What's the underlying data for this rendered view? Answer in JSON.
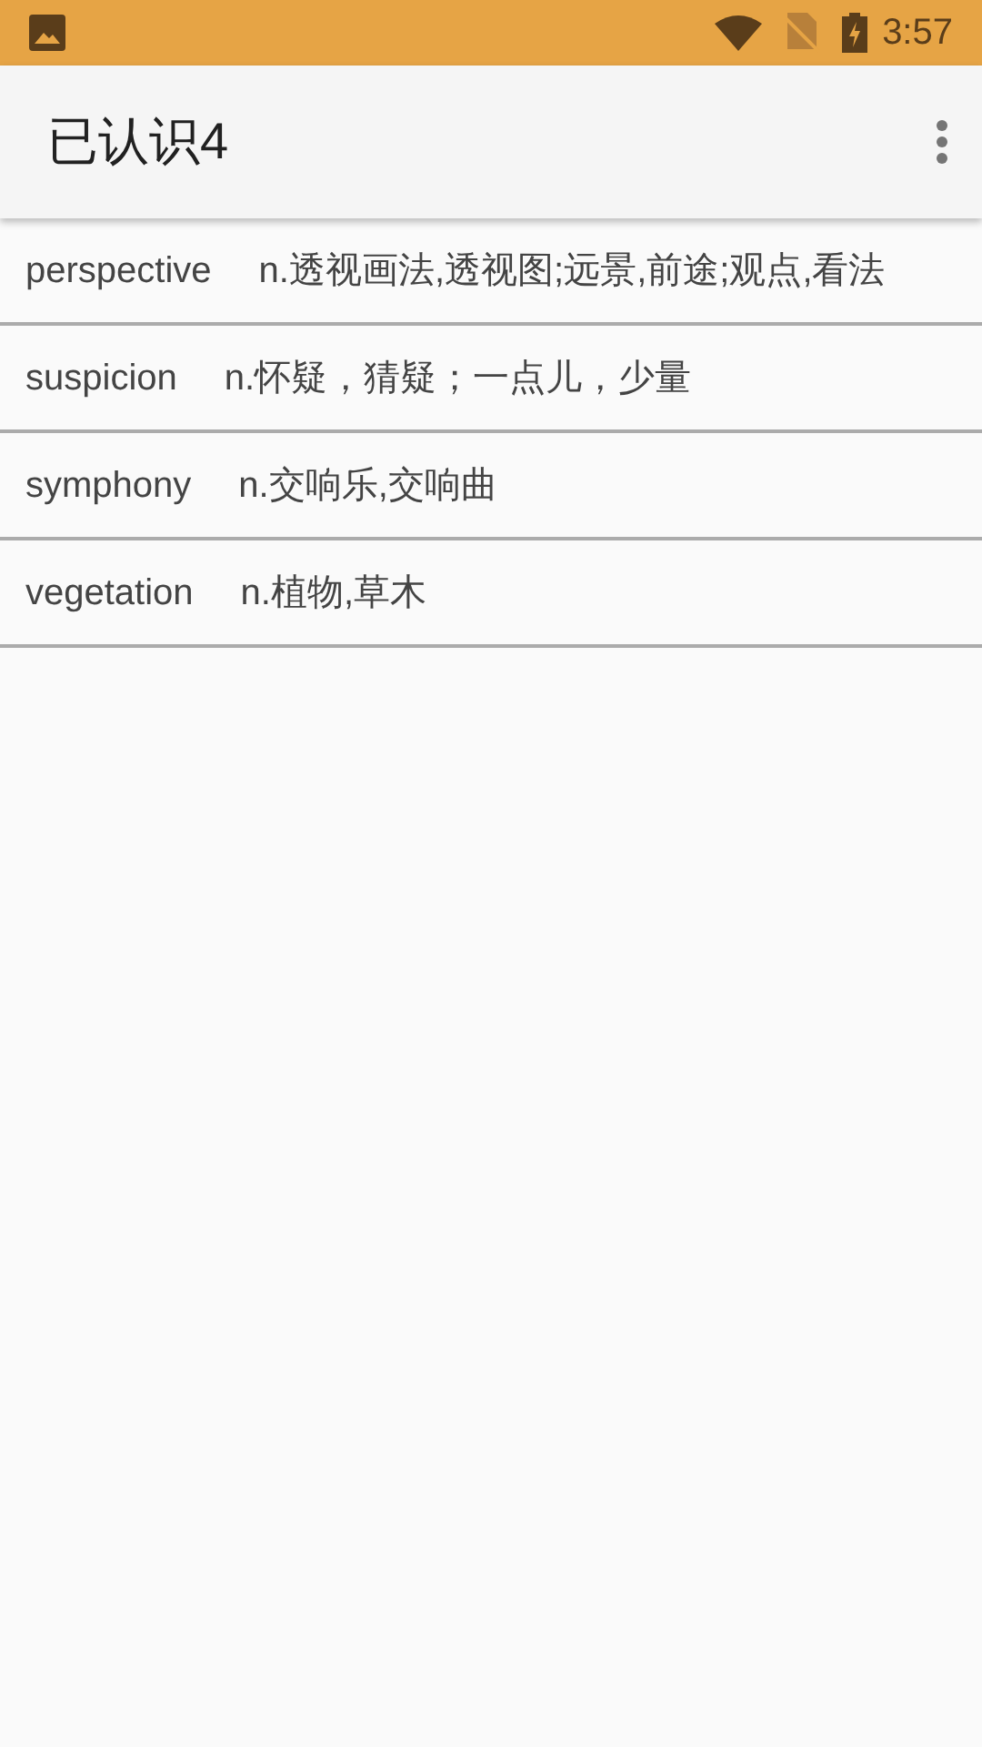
{
  "status_bar": {
    "time": "3:57"
  },
  "app_bar": {
    "title": "已认识4"
  },
  "words": [
    {
      "word": "perspective",
      "meaning": "n.透视画法,透视图;远景,前途;观点,看法"
    },
    {
      "word": "suspicion",
      "meaning": "n.怀疑，猜疑；一点儿，少量"
    },
    {
      "word": "symphony",
      "meaning": "n.交响乐,交响曲"
    },
    {
      "word": "vegetation",
      "meaning": "n.植物,草木"
    }
  ]
}
